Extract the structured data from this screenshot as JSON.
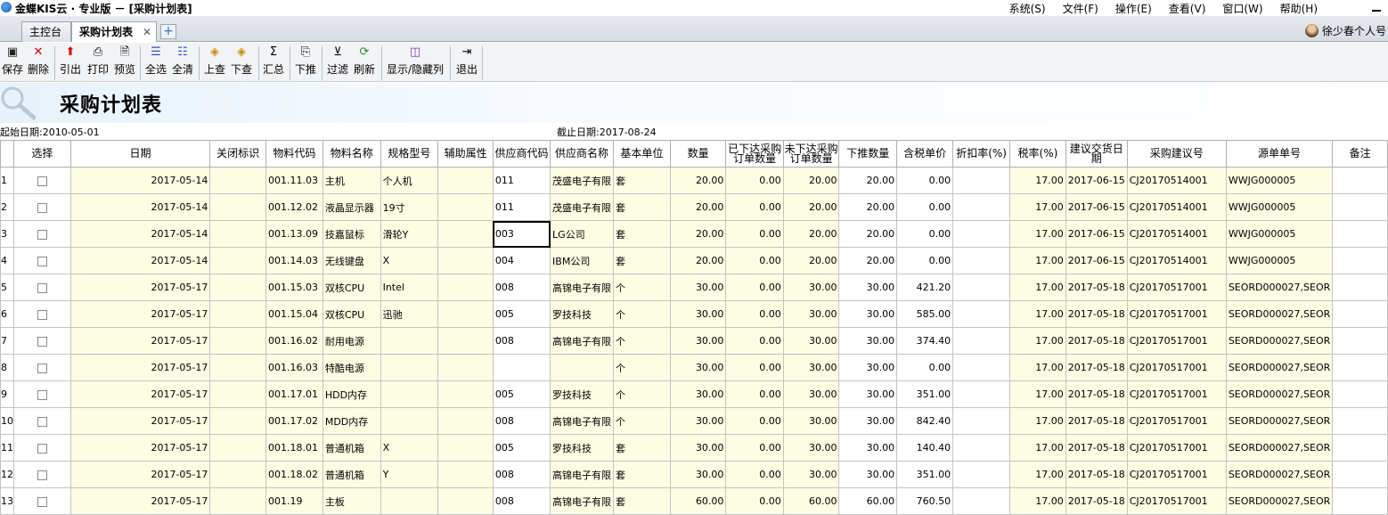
{
  "window": {
    "title": "金蝶KIS云 · 专业版 － [采购计划表]",
    "menus": [
      "系统(S)",
      "文件(F)",
      "操作(E)",
      "查看(V)",
      "窗口(W)",
      "帮助(H)"
    ]
  },
  "tabs": [
    {
      "label": "主控台",
      "active": false
    },
    {
      "label": "采购计划表",
      "active": true
    }
  ],
  "user": {
    "name": "徐少春个人号"
  },
  "toolbar": {
    "save": "保存",
    "delete": "删除",
    "export": "引出",
    "print": "打印",
    "preview": "预览",
    "select_all": "全选",
    "clear_all": "全清",
    "prev": "上查",
    "next": "下查",
    "summary": "汇总",
    "push_down": "下推",
    "filter": "过滤",
    "refresh": "刷新",
    "show_hide_cols": "显示/隐藏列",
    "exit": "退出"
  },
  "report": {
    "title": "采购计划表",
    "start_date": "起始日期:2010-05-01",
    "end_date": "截止日期:2017-08-24"
  },
  "table": {
    "columns": {
      "select": "选择",
      "date": "日期",
      "close_flag": "关闭标识",
      "item_code": "物料代码",
      "item_name": "物料名称",
      "spec": "规格型号",
      "aux": "辅助属性",
      "supplier_code": "供应商代码",
      "supplier_name": "供应商名称",
      "unit": "基本单位",
      "qty": "数量",
      "ordered_qty": "已下达采购订单数量",
      "unordered_qty": "未下达采购订单数量",
      "push_qty": "下推数量",
      "tax_price": "含税单价",
      "discount": "折扣率(%)",
      "tax_rate": "税率(%)",
      "delivery_date": "建议交货日期",
      "suggest_no": "采购建议号",
      "source_no": "源单单号",
      "remark": "备注"
    },
    "rows": [
      {
        "rn": "1",
        "date": "2017-05-14",
        "code": "001.11.03",
        "name": "主机",
        "spec": "个人机",
        "sup_code": "011",
        "sup_name": "茂盛电子有限",
        "unit": "套",
        "qty": "20.00",
        "ordered": "0.00",
        "unordered": "20.00",
        "push": "20.00",
        "price": "0.00",
        "tax": "17.00",
        "delivery": "2017-06-15",
        "suggest": "CJ20170514001",
        "source": "WWJG000005"
      },
      {
        "rn": "2",
        "date": "2017-05-14",
        "code": "001.12.02",
        "name": "液晶显示器",
        "spec": "19寸",
        "sup_code": "011",
        "sup_name": "茂盛电子有限",
        "unit": "套",
        "qty": "20.00",
        "ordered": "0.00",
        "unordered": "20.00",
        "push": "20.00",
        "price": "0.00",
        "tax": "17.00",
        "delivery": "2017-06-15",
        "suggest": "CJ20170514001",
        "source": "WWJG000005"
      },
      {
        "rn": "3",
        "date": "2017-05-14",
        "code": "001.13.09",
        "name": "技嘉鼠标",
        "spec": "滑轮Y",
        "sup_code": "003",
        "sup_name": "LG公司",
        "unit": "套",
        "qty": "20.00",
        "ordered": "0.00",
        "unordered": "20.00",
        "push": "20.00",
        "price": "0.00",
        "tax": "17.00",
        "delivery": "2017-06-15",
        "suggest": "CJ20170514001",
        "source": "WWJG000005"
      },
      {
        "rn": "4",
        "date": "2017-05-14",
        "code": "001.14.03",
        "name": "无线键盘",
        "spec": "X",
        "sup_code": "004",
        "sup_name": "IBM公司",
        "unit": "套",
        "qty": "20.00",
        "ordered": "0.00",
        "unordered": "20.00",
        "push": "20.00",
        "price": "0.00",
        "tax": "17.00",
        "delivery": "2017-06-15",
        "suggest": "CJ20170514001",
        "source": "WWJG000005"
      },
      {
        "rn": "5",
        "date": "2017-05-17",
        "code": "001.15.03",
        "name": "双核CPU",
        "spec": "Intel",
        "sup_code": "008",
        "sup_name": "高锦电子有限",
        "unit": "个",
        "qty": "30.00",
        "ordered": "0.00",
        "unordered": "30.00",
        "push": "30.00",
        "price": "421.20",
        "tax": "17.00",
        "delivery": "2017-05-18",
        "suggest": "CJ20170517001",
        "source": "SEORD000027,SEOR"
      },
      {
        "rn": "6",
        "date": "2017-05-17",
        "code": "001.15.04",
        "name": "双核CPU",
        "spec": "迅驰",
        "sup_code": "005",
        "sup_name": "罗技科技",
        "unit": "个",
        "qty": "30.00",
        "ordered": "0.00",
        "unordered": "30.00",
        "push": "30.00",
        "price": "585.00",
        "tax": "17.00",
        "delivery": "2017-05-18",
        "suggest": "CJ20170517001",
        "source": "SEORD000027,SEOR"
      },
      {
        "rn": "7",
        "date": "2017-05-17",
        "code": "001.16.02",
        "name": "耐用电源",
        "spec": "",
        "sup_code": "008",
        "sup_name": "高锦电子有限",
        "unit": "个",
        "qty": "30.00",
        "ordered": "0.00",
        "unordered": "30.00",
        "push": "30.00",
        "price": "374.40",
        "tax": "17.00",
        "delivery": "2017-05-18",
        "suggest": "CJ20170517001",
        "source": "SEORD000027,SEOR"
      },
      {
        "rn": "8",
        "date": "2017-05-17",
        "code": "001.16.03",
        "name": "特酷电源",
        "spec": "",
        "sup_code": "",
        "sup_name": "",
        "unit": "个",
        "qty": "30.00",
        "ordered": "0.00",
        "unordered": "30.00",
        "push": "30.00",
        "price": "0.00",
        "tax": "17.00",
        "delivery": "2017-05-18",
        "suggest": "CJ20170517001",
        "source": "SEORD000027,SEOR"
      },
      {
        "rn": "9",
        "date": "2017-05-17",
        "code": "001.17.01",
        "name": "HDD内存",
        "spec": "",
        "sup_code": "005",
        "sup_name": "罗技科技",
        "unit": "个",
        "qty": "30.00",
        "ordered": "0.00",
        "unordered": "30.00",
        "push": "30.00",
        "price": "351.00",
        "tax": "17.00",
        "delivery": "2017-05-18",
        "suggest": "CJ20170517001",
        "source": "SEORD000027,SEOR"
      },
      {
        "rn": "10",
        "date": "2017-05-17",
        "code": "001.17.02",
        "name": "MDD内存",
        "spec": "",
        "sup_code": "008",
        "sup_name": "高锦电子有限",
        "unit": "个",
        "qty": "30.00",
        "ordered": "0.00",
        "unordered": "30.00",
        "push": "30.00",
        "price": "842.40",
        "tax": "17.00",
        "delivery": "2017-05-18",
        "suggest": "CJ20170517001",
        "source": "SEORD000027,SEOR"
      },
      {
        "rn": "11",
        "date": "2017-05-17",
        "code": "001.18.01",
        "name": "普通机箱",
        "spec": "X",
        "sup_code": "005",
        "sup_name": "罗技科技",
        "unit": "套",
        "qty": "30.00",
        "ordered": "0.00",
        "unordered": "30.00",
        "push": "30.00",
        "price": "140.40",
        "tax": "17.00",
        "delivery": "2017-05-18",
        "suggest": "CJ20170517001",
        "source": "SEORD000027,SEOR"
      },
      {
        "rn": "12",
        "date": "2017-05-17",
        "code": "001.18.02",
        "name": "普通机箱",
        "spec": "Y",
        "sup_code": "008",
        "sup_name": "高锦电子有限",
        "unit": "套",
        "qty": "30.00",
        "ordered": "0.00",
        "unordered": "30.00",
        "push": "30.00",
        "price": "351.00",
        "tax": "17.00",
        "delivery": "2017-05-18",
        "suggest": "CJ20170517001",
        "source": "SEORD000027,SEOR"
      },
      {
        "rn": "13",
        "date": "2017-05-17",
        "code": "001.19",
        "name": "主板",
        "spec": "",
        "sup_code": "008",
        "sup_name": "高锦电子有限",
        "unit": "套",
        "qty": "60.00",
        "ordered": "0.00",
        "unordered": "60.00",
        "push": "60.00",
        "price": "760.50",
        "tax": "17.00",
        "delivery": "2017-05-18",
        "suggest": "CJ20170517001",
        "source": "SEORD000027,SEOR"
      }
    ]
  }
}
